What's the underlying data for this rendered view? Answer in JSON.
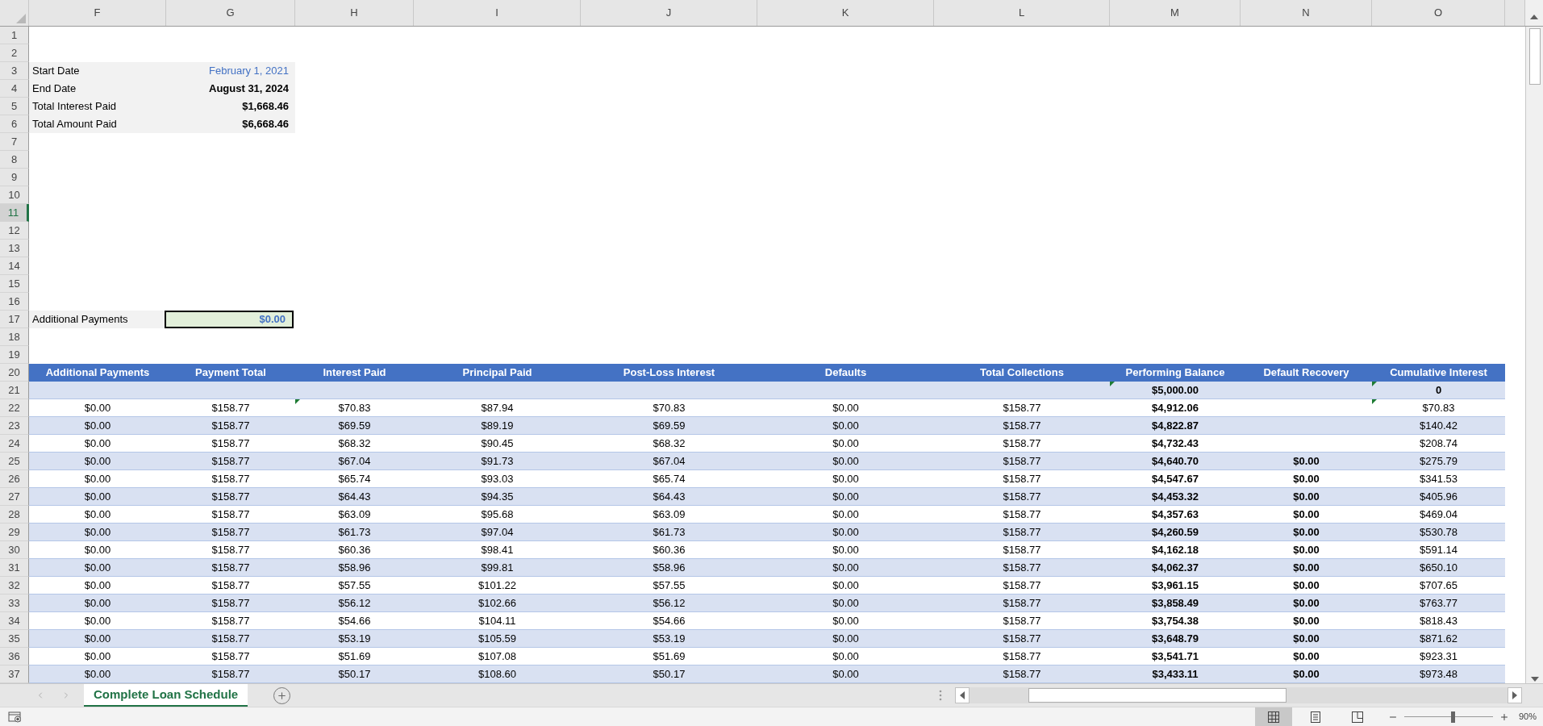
{
  "columns": [
    "F",
    "G",
    "H",
    "I",
    "J",
    "K",
    "L",
    "M",
    "N",
    "O"
  ],
  "rows": [
    {
      "label": "1",
      "selected": false
    },
    {
      "label": "2",
      "selected": false
    },
    {
      "label": "3",
      "selected": false
    },
    {
      "label": "4",
      "selected": false
    },
    {
      "label": "5",
      "selected": false
    },
    {
      "label": "6",
      "selected": false
    },
    {
      "label": "7",
      "selected": false
    },
    {
      "label": "8",
      "selected": false
    },
    {
      "label": "9",
      "selected": false
    },
    {
      "label": "10",
      "selected": false
    },
    {
      "label": "11",
      "selected": true
    },
    {
      "label": "12",
      "selected": false
    },
    {
      "label": "13",
      "selected": false
    },
    {
      "label": "14",
      "selected": false
    },
    {
      "label": "15",
      "selected": false
    },
    {
      "label": "16",
      "selected": false
    },
    {
      "label": "17",
      "selected": false
    },
    {
      "label": "18",
      "selected": false
    },
    {
      "label": "19",
      "selected": false
    },
    {
      "label": "20",
      "selected": false
    },
    {
      "label": "21",
      "selected": false
    },
    {
      "label": "22",
      "selected": false
    },
    {
      "label": "23",
      "selected": false
    },
    {
      "label": "24",
      "selected": false
    },
    {
      "label": "25",
      "selected": false
    },
    {
      "label": "26",
      "selected": false
    },
    {
      "label": "27",
      "selected": false
    },
    {
      "label": "28",
      "selected": false
    },
    {
      "label": "29",
      "selected": false
    },
    {
      "label": "30",
      "selected": false
    },
    {
      "label": "31",
      "selected": false
    },
    {
      "label": "32",
      "selected": false
    },
    {
      "label": "33",
      "selected": false
    },
    {
      "label": "34",
      "selected": false
    },
    {
      "label": "35",
      "selected": false
    },
    {
      "label": "36",
      "selected": false
    },
    {
      "label": "37",
      "selected": false
    }
  ],
  "summary": [
    {
      "label": "Start Date",
      "value": "February 1, 2021",
      "kind": "input"
    },
    {
      "label": "End Date",
      "value": "August 31, 2024",
      "kind": "calc"
    },
    {
      "label": "Total Interest Paid",
      "value": "$1,668.46",
      "kind": "calc"
    },
    {
      "label": "Total Amount Paid",
      "value": "$6,668.46",
      "kind": "calc"
    }
  ],
  "additional_payments": {
    "label": "Additional Payments",
    "value": "$0.00"
  },
  "table": {
    "columns": [
      {
        "label": "Additional Payments",
        "bold": false
      },
      {
        "label": "Payment Total",
        "bold": false
      },
      {
        "label": "Interest Paid",
        "bold": false
      },
      {
        "label": "Principal Paid",
        "bold": false
      },
      {
        "label": "Post-Loss Interest",
        "bold": false
      },
      {
        "label": "Defaults",
        "bold": false
      },
      {
        "label": "Total Collections",
        "bold": false
      },
      {
        "label": "Performing Balance",
        "bold": true
      },
      {
        "label": "Default Recovery",
        "bold": true
      },
      {
        "label": "Cumulative Interest",
        "bold": false
      }
    ],
    "rows": [
      {
        "cells": [
          null,
          null,
          null,
          null,
          null,
          null,
          null,
          "$5,000.00",
          null,
          "0"
        ],
        "flagged": [
          false,
          false,
          false,
          false,
          false,
          false,
          false,
          true,
          false,
          true
        ],
        "bold_all": true
      },
      {
        "cells": [
          "$0.00",
          "$158.77",
          "$70.83",
          "$87.94",
          "$70.83",
          "$0.00",
          "$158.77",
          "$4,912.06",
          null,
          "$70.83"
        ],
        "flagged": [
          false,
          false,
          true,
          false,
          false,
          false,
          false,
          false,
          false,
          true
        ],
        "bold_all": false
      },
      {
        "cells": [
          "$0.00",
          "$158.77",
          "$69.59",
          "$89.19",
          "$69.59",
          "$0.00",
          "$158.77",
          "$4,822.87",
          null,
          "$140.42"
        ],
        "bold_all": false
      },
      {
        "cells": [
          "$0.00",
          "$158.77",
          "$68.32",
          "$90.45",
          "$68.32",
          "$0.00",
          "$158.77",
          "$4,732.43",
          null,
          "$208.74"
        ],
        "bold_all": false
      },
      {
        "cells": [
          "$0.00",
          "$158.77",
          "$67.04",
          "$91.73",
          "$67.04",
          "$0.00",
          "$158.77",
          "$4,640.70",
          "$0.00",
          "$275.79"
        ],
        "bold_all": false
      },
      {
        "cells": [
          "$0.00",
          "$158.77",
          "$65.74",
          "$93.03",
          "$65.74",
          "$0.00",
          "$158.77",
          "$4,547.67",
          "$0.00",
          "$341.53"
        ],
        "bold_all": false
      },
      {
        "cells": [
          "$0.00",
          "$158.77",
          "$64.43",
          "$94.35",
          "$64.43",
          "$0.00",
          "$158.77",
          "$4,453.32",
          "$0.00",
          "$405.96"
        ],
        "bold_all": false
      },
      {
        "cells": [
          "$0.00",
          "$158.77",
          "$63.09",
          "$95.68",
          "$63.09",
          "$0.00",
          "$158.77",
          "$4,357.63",
          "$0.00",
          "$469.04"
        ],
        "bold_all": false
      },
      {
        "cells": [
          "$0.00",
          "$158.77",
          "$61.73",
          "$97.04",
          "$61.73",
          "$0.00",
          "$158.77",
          "$4,260.59",
          "$0.00",
          "$530.78"
        ],
        "bold_all": false
      },
      {
        "cells": [
          "$0.00",
          "$158.77",
          "$60.36",
          "$98.41",
          "$60.36",
          "$0.00",
          "$158.77",
          "$4,162.18",
          "$0.00",
          "$591.14"
        ],
        "bold_all": false
      },
      {
        "cells": [
          "$0.00",
          "$158.77",
          "$58.96",
          "$99.81",
          "$58.96",
          "$0.00",
          "$158.77",
          "$4,062.37",
          "$0.00",
          "$650.10"
        ],
        "bold_all": false
      },
      {
        "cells": [
          "$0.00",
          "$158.77",
          "$57.55",
          "$101.22",
          "$57.55",
          "$0.00",
          "$158.77",
          "$3,961.15",
          "$0.00",
          "$707.65"
        ],
        "bold_all": false
      },
      {
        "cells": [
          "$0.00",
          "$158.77",
          "$56.12",
          "$102.66",
          "$56.12",
          "$0.00",
          "$158.77",
          "$3,858.49",
          "$0.00",
          "$763.77"
        ],
        "bold_all": false
      },
      {
        "cells": [
          "$0.00",
          "$158.77",
          "$54.66",
          "$104.11",
          "$54.66",
          "$0.00",
          "$158.77",
          "$3,754.38",
          "$0.00",
          "$818.43"
        ],
        "bold_all": false
      },
      {
        "cells": [
          "$0.00",
          "$158.77",
          "$53.19",
          "$105.59",
          "$53.19",
          "$0.00",
          "$158.77",
          "$3,648.79",
          "$0.00",
          "$871.62"
        ],
        "bold_all": false
      },
      {
        "cells": [
          "$0.00",
          "$158.77",
          "$51.69",
          "$107.08",
          "$51.69",
          "$0.00",
          "$158.77",
          "$3,541.71",
          "$0.00",
          "$923.31"
        ],
        "bold_all": false
      },
      {
        "cells": [
          "$0.00",
          "$158.77",
          "$50.17",
          "$108.60",
          "$50.17",
          "$0.00",
          "$158.77",
          "$3,433.11",
          "$0.00",
          "$973.48"
        ],
        "bold_all": false
      }
    ]
  },
  "sheet_tabs": [
    {
      "label": "Complete Loan Schedule",
      "selected": true
    }
  ],
  "status_bar": {
    "views": [
      {
        "kind": "normal",
        "selected": true
      },
      {
        "kind": "page_layout",
        "selected": false
      },
      {
        "kind": "page_break",
        "selected": false
      }
    ],
    "zoom": {
      "level": 0.55,
      "label": "90%"
    }
  }
}
